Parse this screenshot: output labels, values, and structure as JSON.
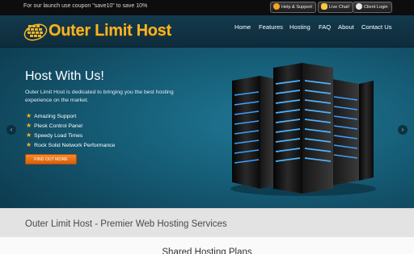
{
  "topbar": {
    "promo": "For our launch use coupon \"save10\" to save 10%",
    "buttons": [
      {
        "label": "Help & Support",
        "icon": "lifebuoy-icon"
      },
      {
        "label": "Live Chat!",
        "icon": "chat-bubble-icon"
      },
      {
        "label": "Client Login",
        "icon": "user-icon"
      }
    ]
  },
  "header": {
    "logo_text": "Outer Limit Host",
    "nav": [
      "Home",
      "Features",
      "Hosting",
      "FAQ",
      "About",
      "Contact Us"
    ]
  },
  "hero": {
    "title": "Host With Us!",
    "description": "Outer Limit Host is dedicated to bringing you the best hosting experience on the market.",
    "features": [
      "Amazing Support",
      "Plesk Control Panel",
      "Speedy Load Times",
      "Rock Solid Network Performance"
    ],
    "cta_label": "FIND OUT MORE",
    "prev_arrow": "‹",
    "next_arrow": "›"
  },
  "band": {
    "text": "Outer Limit Host - Premier Web Hosting Services"
  },
  "plans": {
    "title": "Shared Hosting Plans"
  },
  "colors": {
    "accent": "#f6b425",
    "cta": "#f07a20",
    "hero_bg": "#165e78",
    "server_glow": "#3aa0ff"
  }
}
